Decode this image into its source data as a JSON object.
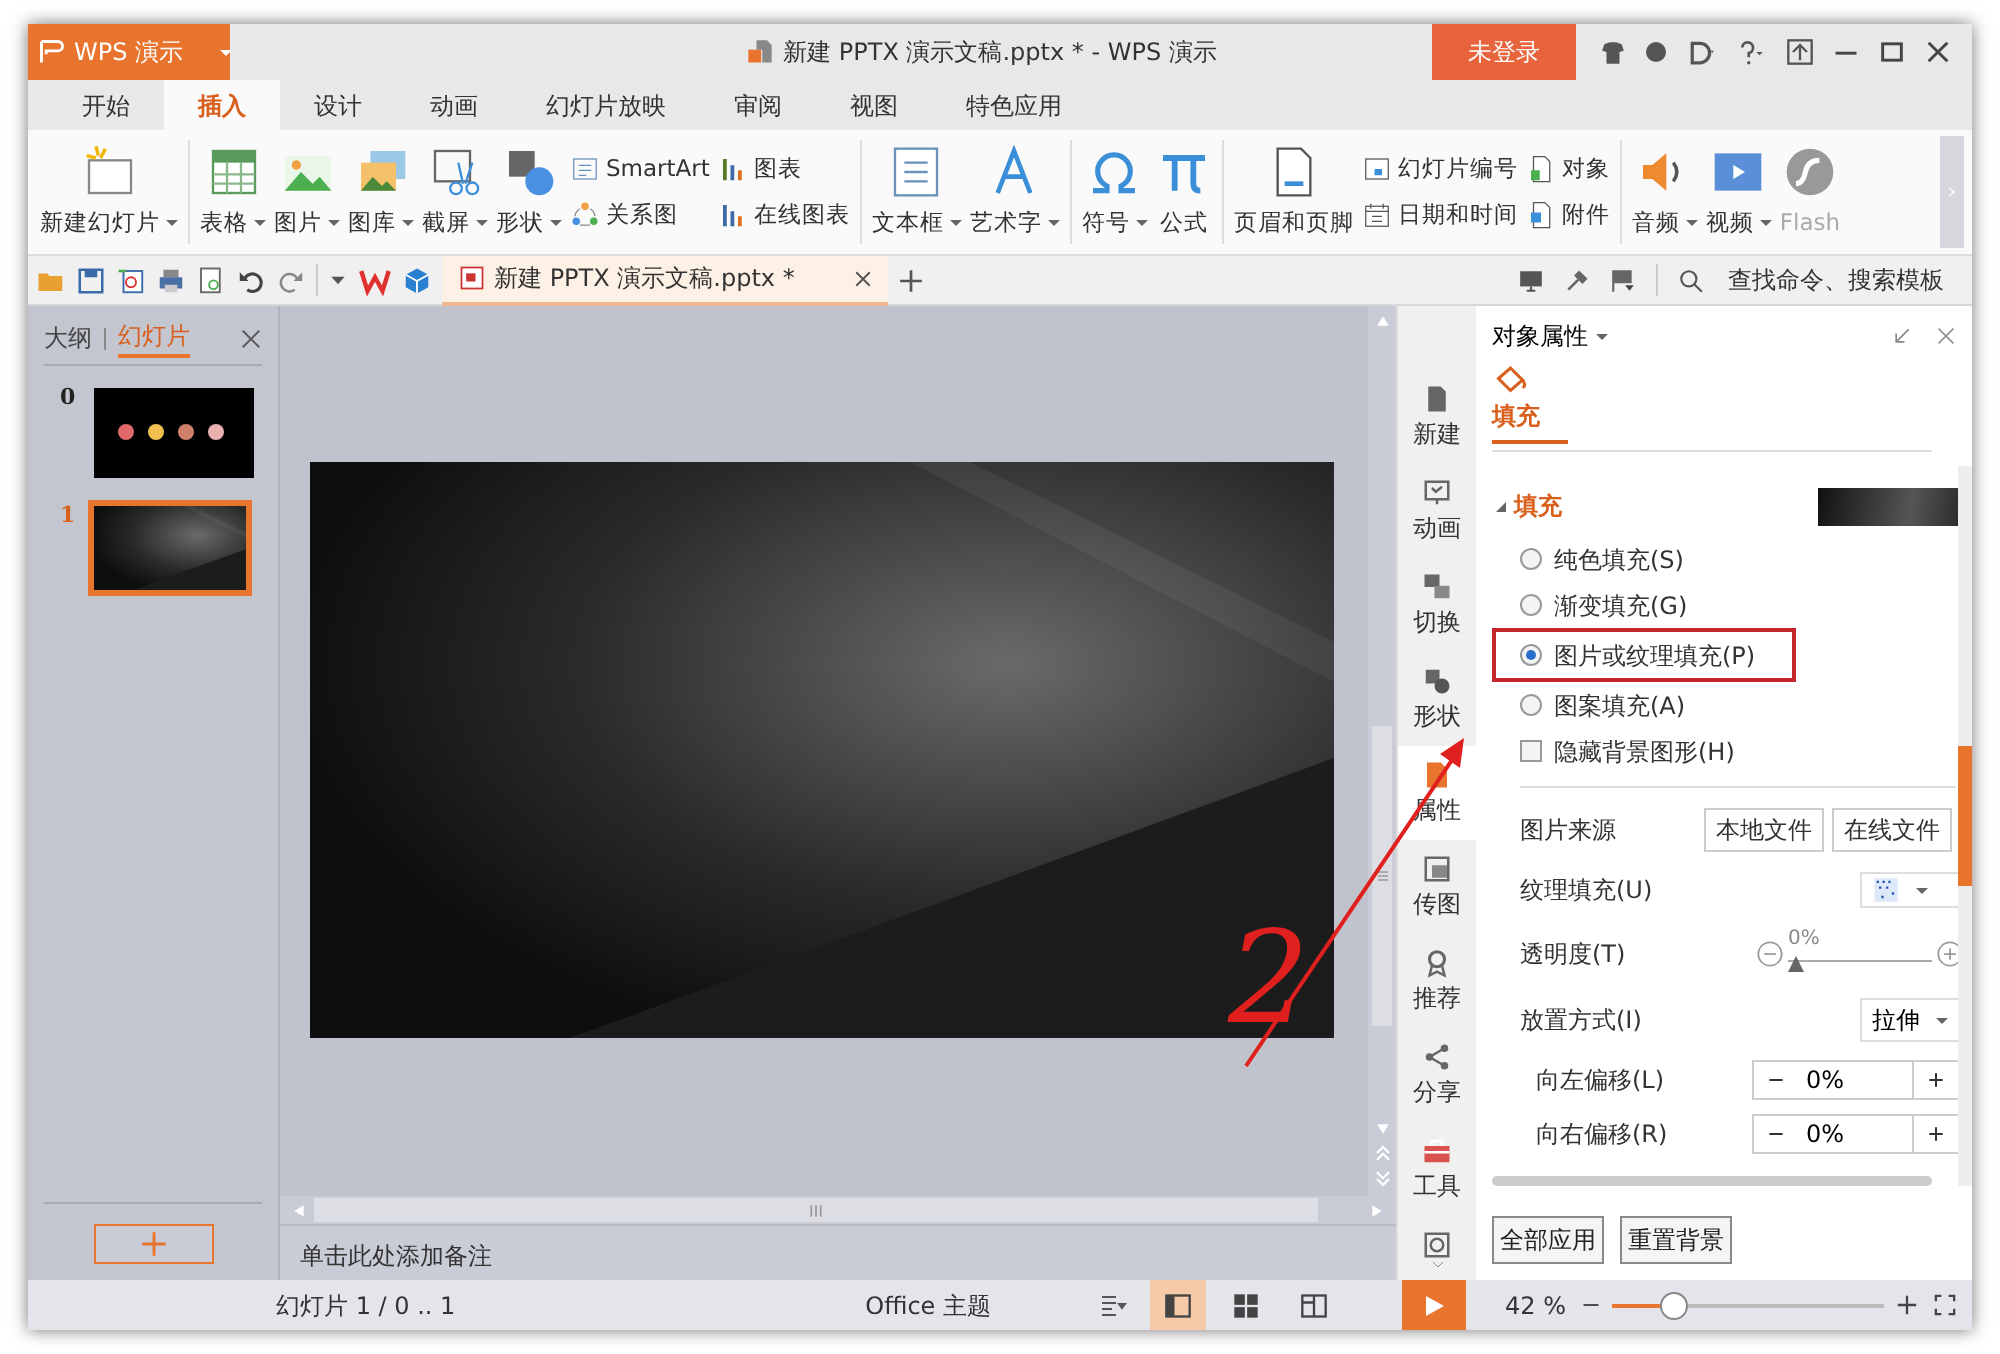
{
  "title_bar": {
    "app_menu": "WPS 演示",
    "title": "新建 PPTX 演示文稿.pptx * - WPS 演示",
    "login": "未登录"
  },
  "menu_tabs": [
    {
      "label": "开始",
      "selected": false
    },
    {
      "label": "插入",
      "selected": true
    },
    {
      "label": "设计",
      "selected": false
    },
    {
      "label": "动画",
      "selected": false
    },
    {
      "label": "幻灯片放映",
      "selected": false
    },
    {
      "label": "审阅",
      "selected": false
    },
    {
      "label": "视图",
      "selected": false
    },
    {
      "label": "特色应用",
      "selected": false
    }
  ],
  "ribbon": [
    {
      "kind": "large",
      "label": "新建幻灯片",
      "dropdown": true,
      "disabled": false
    },
    {
      "kind": "separator"
    },
    {
      "kind": "large",
      "label": "表格",
      "dropdown": true,
      "disabled": false
    },
    {
      "kind": "large",
      "label": "图片",
      "dropdown": true,
      "disabled": false
    },
    {
      "kind": "large",
      "label": "图库",
      "dropdown": true,
      "disabled": false
    },
    {
      "kind": "large",
      "label": "截屏",
      "dropdown": true,
      "disabled": false
    },
    {
      "kind": "large",
      "label": "形状",
      "dropdown": true,
      "disabled": false
    },
    {
      "kind": "stack",
      "items": [
        {
          "label": "SmartArt"
        },
        {
          "label": "关系图"
        }
      ]
    },
    {
      "kind": "stack",
      "items": [
        {
          "label": "图表"
        },
        {
          "label": "在线图表"
        }
      ]
    },
    {
      "kind": "separator"
    },
    {
      "kind": "large",
      "label": "文本框",
      "dropdown": true,
      "disabled": false
    },
    {
      "kind": "large",
      "label": "艺术字",
      "dropdown": true,
      "disabled": false
    },
    {
      "kind": "separator"
    },
    {
      "kind": "large",
      "label": "符号",
      "dropdown": true,
      "disabled": false
    },
    {
      "kind": "large",
      "label": "公式",
      "dropdown": false,
      "disabled": false
    },
    {
      "kind": "separator"
    },
    {
      "kind": "large",
      "label": "页眉和页脚",
      "dropdown": false,
      "disabled": false
    },
    {
      "kind": "stack",
      "items": [
        {
          "label": "幻灯片编号"
        },
        {
          "label": "日期和时间"
        }
      ]
    },
    {
      "kind": "stack",
      "items": [
        {
          "label": "对象"
        },
        {
          "label": "附件"
        }
      ]
    },
    {
      "kind": "separator"
    },
    {
      "kind": "large",
      "label": "音频",
      "dropdown": true,
      "disabled": false
    },
    {
      "kind": "large",
      "label": "视频",
      "dropdown": true,
      "disabled": false
    },
    {
      "kind": "large",
      "label": "Flash",
      "dropdown": false,
      "disabled": true
    }
  ],
  "quick_bar": {
    "document_tab": "新建 PPTX 演示文稿.pptx *",
    "search": {
      "placeholder": "查找命令、搜索模板"
    }
  },
  "left_panel": {
    "tabs": [
      {
        "label": "大纲",
        "selected": false
      },
      {
        "label": "幻灯片",
        "selected": true
      }
    ],
    "slides": [
      {
        "number": "0",
        "selected": false
      },
      {
        "number": "1",
        "selected": true
      }
    ]
  },
  "notes": "单击此处添加备注",
  "side_tabs": [
    {
      "label": "新建",
      "selected": false
    },
    {
      "label": "动画",
      "selected": false
    },
    {
      "label": "切换",
      "selected": false
    },
    {
      "label": "形状",
      "selected": false
    },
    {
      "label": "属性",
      "selected": true
    },
    {
      "label": "传图",
      "selected": false
    },
    {
      "label": "推荐",
      "selected": false
    },
    {
      "label": "分享",
      "selected": false
    },
    {
      "label": "工具",
      "selected": false
    }
  ],
  "properties": {
    "title": "对象属性",
    "tab": "填充",
    "section": {
      "label": "填充",
      "expanded": true
    },
    "fill_options": [
      {
        "label": "纯色填充(S)",
        "selected": false,
        "highlighted": false
      },
      {
        "label": "渐变填充(G)",
        "selected": false,
        "highlighted": false
      },
      {
        "label": "图片或纹理填充(P)",
        "selected": true,
        "highlighted": true
      },
      {
        "label": "图案填充(A)",
        "selected": false,
        "highlighted": false
      }
    ],
    "hide_background": {
      "label": "隐藏背景图形(H)",
      "checked": false
    },
    "picture_source": {
      "label": "图片来源",
      "buttons": [
        "本地文件",
        "在线文件"
      ]
    },
    "texture": {
      "label": "纹理填充(U)"
    },
    "transparency": {
      "label": "透明度(T)",
      "level": 0,
      "reading": "0%"
    },
    "placement": {
      "label": "放置方式(I)",
      "value": "拉伸"
    },
    "offsets": [
      {
        "label": "向左偏移(L)",
        "value": "0%"
      },
      {
        "label": "向右偏移(R)",
        "value": "0%"
      }
    ],
    "buttons": [
      "全部应用",
      "重置背景"
    ]
  },
  "status_bar": {
    "slide_info": "幻灯片 1 / 0 .. 1",
    "theme": "Office 主题",
    "views": [
      {
        "selected": true
      },
      {
        "selected": false
      },
      {
        "selected": false
      }
    ],
    "zoom": "42 %",
    "zoom_slider": {
      "level": 0.2
    }
  },
  "annotations": [
    {
      "kind": "arrow"
    },
    {
      "kind": "digit",
      "text": "2"
    }
  ]
}
